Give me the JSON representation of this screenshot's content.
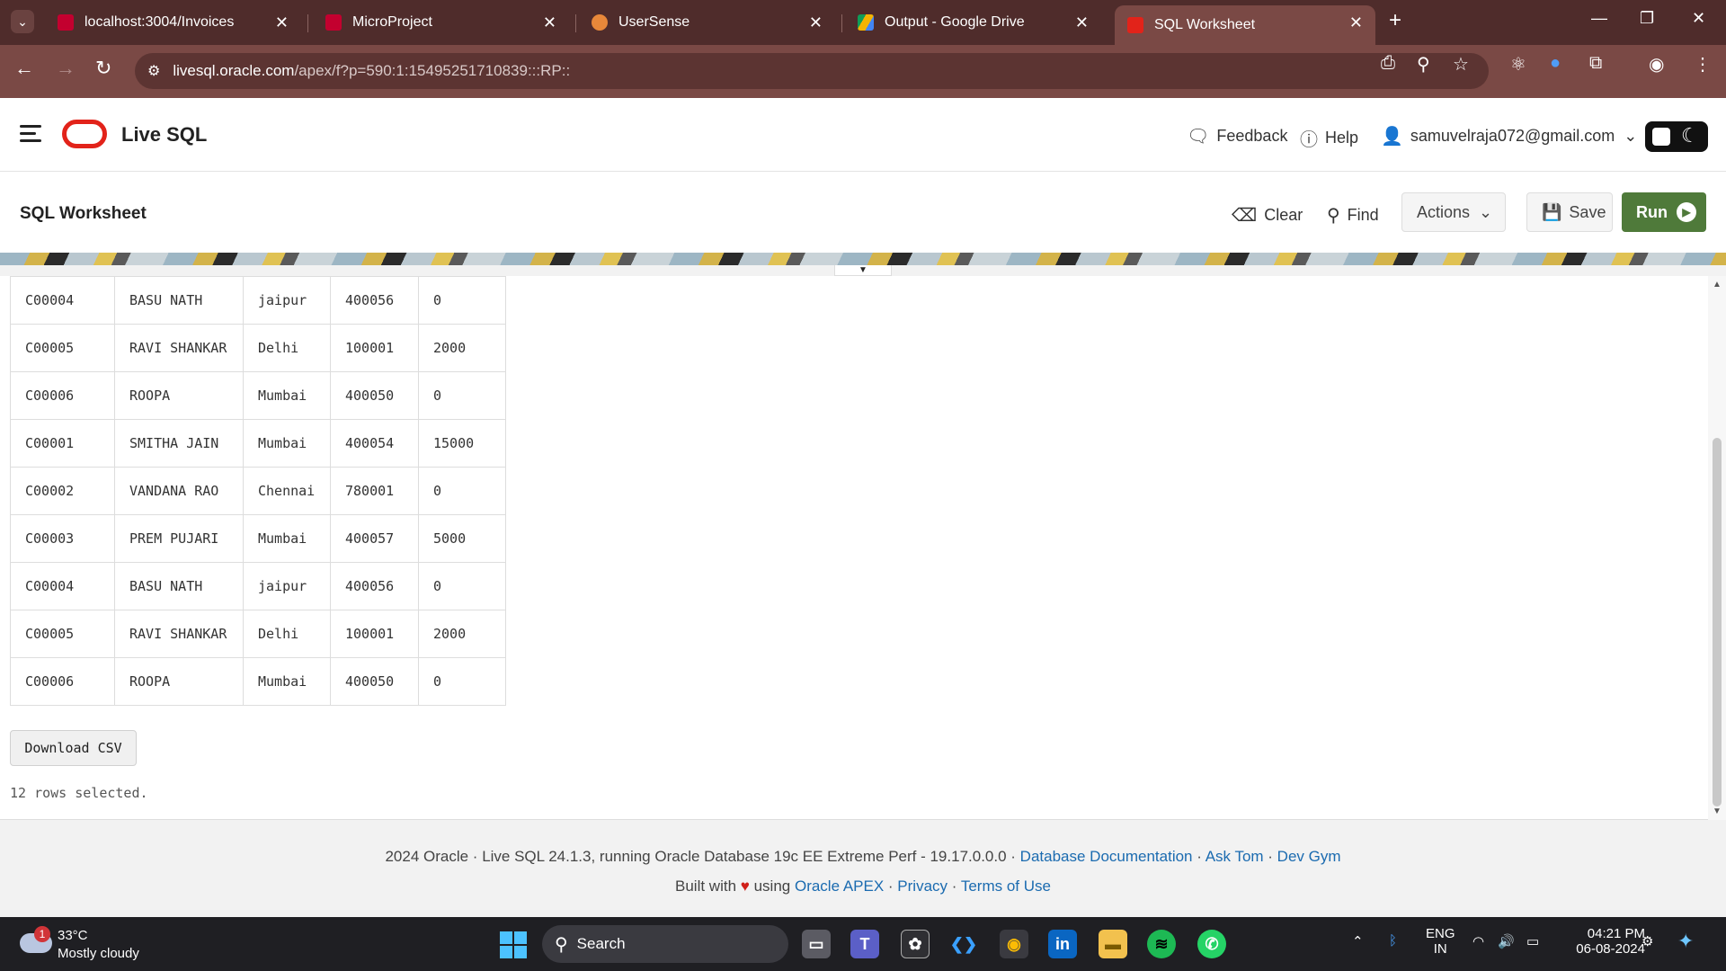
{
  "browser": {
    "tabs": [
      {
        "title": "localhost:3004/Invoices",
        "icon": "angular-icon",
        "color": "#c3002f",
        "active": false
      },
      {
        "title": "MicroProject",
        "icon": "angular-icon",
        "color": "#c3002f",
        "active": false
      },
      {
        "title": "UserSense",
        "icon": "usersense-icon",
        "color": "#e8883a",
        "active": false
      },
      {
        "title": "Output - Google Drive",
        "icon": "google-drive-icon",
        "color": "#f4b400",
        "active": false
      },
      {
        "title": "SQL Worksheet",
        "icon": "oracle-sql-icon",
        "color": "#e2231a",
        "active": true
      }
    ],
    "url_host": "livesql.oracle.com",
    "url_path": "/apex/f?p=590:1:15495251710839:::RP::"
  },
  "app": {
    "title": "Live SQL",
    "feedback": "Feedback",
    "help": "Help",
    "user": "samuvelraja072@gmail.com"
  },
  "toolbar": {
    "title": "SQL Worksheet",
    "clear": "Clear",
    "find": "Find",
    "actions": "Actions",
    "save": "Save",
    "run": "Run"
  },
  "results": {
    "rows": [
      [
        "C00004",
        "BASU NATH",
        "jaipur",
        "400056",
        "0"
      ],
      [
        "C00005",
        "RAVI SHANKAR",
        "Delhi",
        "100001",
        "2000"
      ],
      [
        "C00006",
        "ROOPA",
        "Mumbai",
        "400050",
        "0"
      ],
      [
        "C00001",
        "SMITHA JAIN",
        "Mumbai",
        "400054",
        "15000"
      ],
      [
        "C00002",
        "VANDANA RAO",
        "Chennai",
        "780001",
        "0"
      ],
      [
        "C00003",
        "PREM PUJARI",
        "Mumbai",
        "400057",
        "5000"
      ],
      [
        "C00004",
        "BASU NATH",
        "jaipur",
        "400056",
        "0"
      ],
      [
        "C00005",
        "RAVI SHANKAR",
        "Delhi",
        "100001",
        "2000"
      ],
      [
        "C00006",
        "ROOPA",
        "Mumbai",
        "400050",
        "0"
      ]
    ],
    "download": "Download CSV",
    "rowcount": "12 rows selected."
  },
  "footer": {
    "line1_text": "2024 Oracle · Live SQL 24.1.3, running Oracle Database 19c EE Extreme Perf - 19.17.0.0.0 ·",
    "db_docs": "Database Documentation",
    "ask_tom": "Ask Tom",
    "dev_gym": "Dev Gym",
    "built_with": "Built with",
    "using": "using",
    "apex": "Oracle APEX",
    "privacy": "Privacy",
    "terms": "Terms of Use"
  },
  "taskbar": {
    "weather_badge": "1",
    "temp": "33°C",
    "condition": "Mostly cloudy",
    "search": "Search",
    "lang1": "ENG",
    "lang2": "IN",
    "time": "04:21 PM",
    "date": "06-08-2024"
  }
}
